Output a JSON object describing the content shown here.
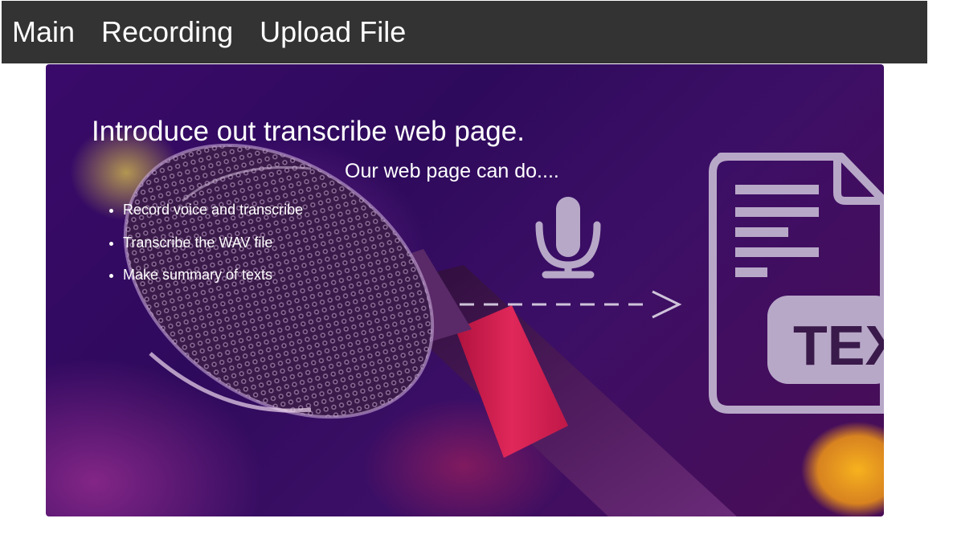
{
  "nav": {
    "items": [
      {
        "label": "Main"
      },
      {
        "label": "Recording"
      },
      {
        "label": "Upload File"
      }
    ]
  },
  "hero": {
    "title": "Introduce out transcribe web page.",
    "subtitle": "Our web page can do....",
    "features": [
      "Record voice and transcribe",
      "Transcribe the WAV file",
      "Make summary of texts"
    ],
    "badge_text": "TEX",
    "icons": [
      "microphone-photo",
      "microphone-icon",
      "dashed-arrow-icon",
      "text-document-icon"
    ]
  },
  "colors": {
    "navbar_bg": "#333333",
    "nav_text": "#ffffff",
    "hero_base": "#2e0a5c",
    "hero_accent_pink": "#d8245a",
    "hero_accent_gold": "#f2a81c",
    "icon_overlay": "#b8a8c8"
  }
}
